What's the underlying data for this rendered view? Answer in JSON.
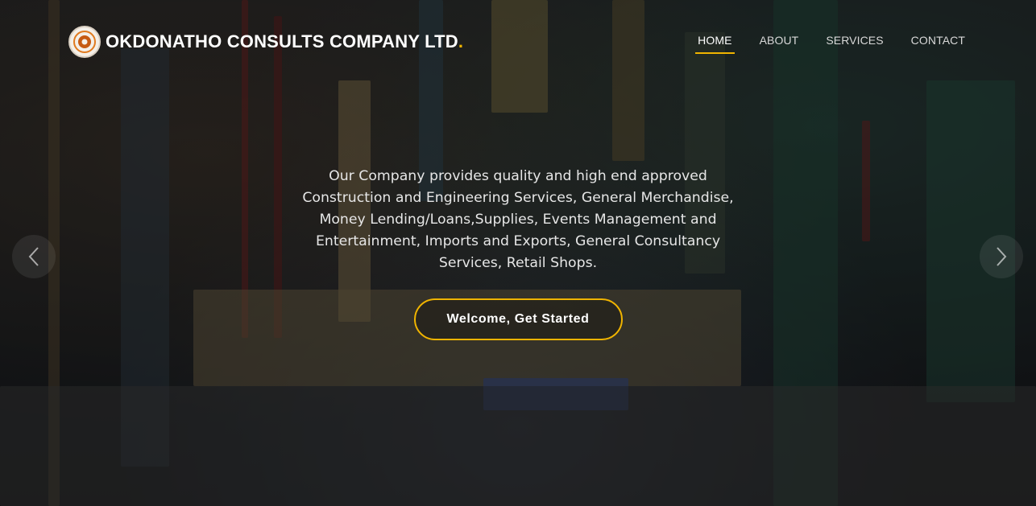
{
  "brand": {
    "name": "OKDONATHO CONSULTS COMPANY LTD",
    "dot": "."
  },
  "nav": {
    "items": [
      {
        "label": "HOME",
        "active": true
      },
      {
        "label": "ABOUT",
        "active": false
      },
      {
        "label": "SERVICES",
        "active": false
      },
      {
        "label": "CONTACT",
        "active": false
      }
    ]
  },
  "hero": {
    "tagline": "Our Company provides quality and high end approved Construction and Engineering Services, General Merchandise, Money Lending/Loans,Supplies, Events Management and Entertainment, Imports and Exports, General Consultancy Services, Retail Shops.",
    "cta_label": "Welcome, Get Started",
    "prev_icon": "chevron-left-icon",
    "next_icon": "chevron-right-icon"
  },
  "colors": {
    "accent": "#f0b400",
    "text": "#ffffff"
  }
}
